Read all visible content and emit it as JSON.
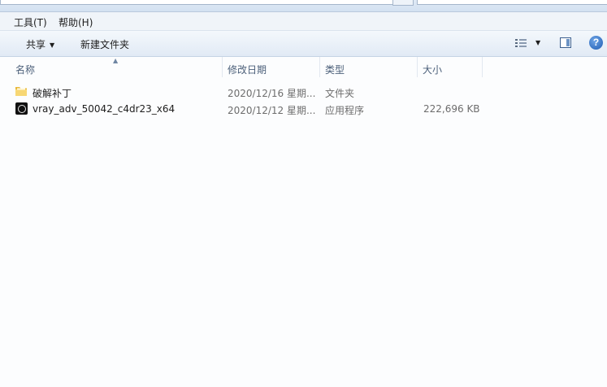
{
  "menu": {
    "items": [
      {
        "label": "工具(T)"
      },
      {
        "label": "帮助(H)"
      }
    ]
  },
  "toolbar": {
    "share_label": "共享",
    "new_folder_label": "新建文件夹",
    "view_icon": "view-options-icon",
    "preview_icon": "preview-pane-icon",
    "help_glyph": "?"
  },
  "columns": {
    "name": "名称",
    "date": "修改日期",
    "type": "类型",
    "size": "大小"
  },
  "files": [
    {
      "name": "破解补丁",
      "date": "2020/12/16 星期...",
      "type": "文件夹",
      "size": "",
      "icon": "folder-icon"
    },
    {
      "name": "vray_adv_50042_c4dr23_x64",
      "date": "2020/12/12 星期...",
      "type": "应用程序",
      "size": "222,696 KB",
      "icon": "vray-app-icon"
    }
  ],
  "colors": {
    "toolbar_bg": "#e1eaf5",
    "menu_bg": "#f0f4f9",
    "header_text": "#4c607a",
    "list_bg": "#fcfdfe"
  }
}
